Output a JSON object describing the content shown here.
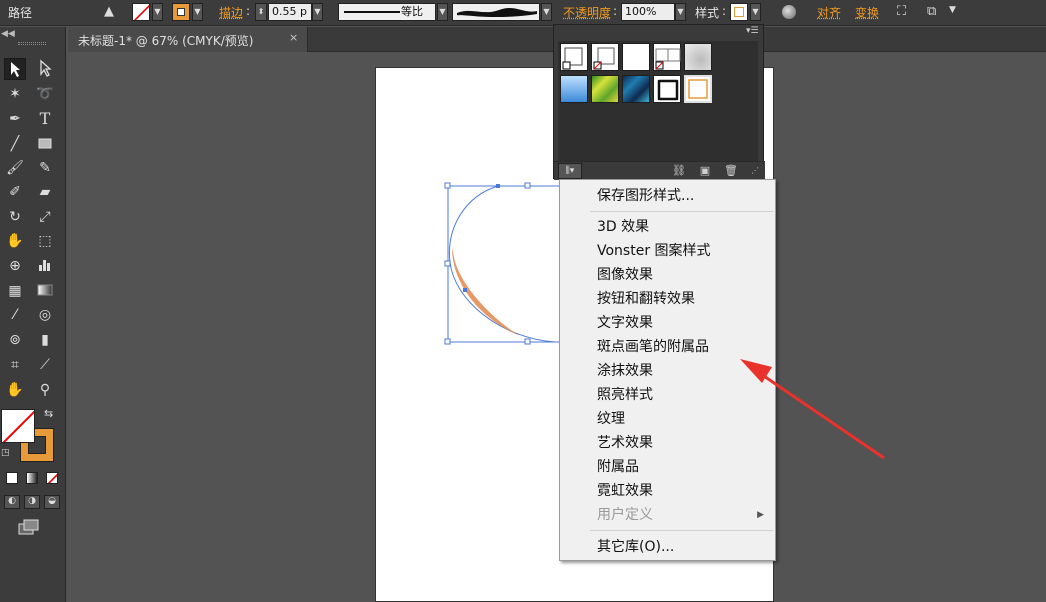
{
  "control_bar": {
    "object_type": "路径",
    "stroke_label": "描边",
    "stroke_weight": "0.55 p",
    "stroke_profile": "等比",
    "opacity_label": "不透明度",
    "opacity_value": "100%",
    "style_label": "样式",
    "align_label": "对齐",
    "transform_label": "变换"
  },
  "document_tab": {
    "title": "未标题-1* @ 67% (CMYK/预览)",
    "close": "×"
  },
  "context_menu": {
    "items": [
      {
        "label": "保存图形样式..."
      },
      {
        "label": "3D 效果"
      },
      {
        "label": "Vonster 图案样式"
      },
      {
        "label": "图像效果"
      },
      {
        "label": "按钮和翻转效果"
      },
      {
        "label": "文字效果"
      },
      {
        "label": "斑点画笔的附属品"
      },
      {
        "label": "涂抹效果"
      },
      {
        "label": "照亮样式"
      },
      {
        "label": "纹理"
      },
      {
        "label": "艺术效果"
      },
      {
        "label": "附属品"
      },
      {
        "label": "霓虹效果"
      },
      {
        "label": "用户定义",
        "disabled": true
      },
      {
        "label": "其它库(O)..."
      }
    ]
  },
  "colors": {
    "accent_orange": "#f39a1e",
    "selection_blue": "#4a7bd8",
    "annotation_red": "#e8322b"
  }
}
